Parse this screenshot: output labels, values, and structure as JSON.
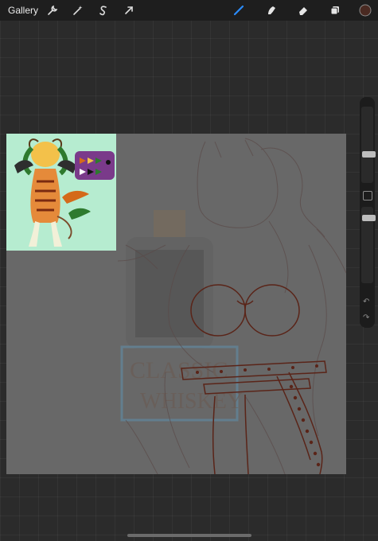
{
  "topbar": {
    "gallery_label": "Gallery",
    "left_tools": [
      "wrench-icon",
      "magic-wand-icon",
      "selection-s-icon",
      "transform-arrow-icon"
    ],
    "right_tools": [
      "brush-icon",
      "smudge-icon",
      "eraser-icon",
      "layers-icon",
      "color-swatch"
    ],
    "active_tool": "brush",
    "active_color": "#4a2a22"
  },
  "canvas": {
    "watermark_line1": "CLASSIC",
    "watermark_line2": "WHISKEY",
    "line_color": "#5a2418",
    "background_color": "#686868"
  },
  "reference": {
    "background_color": "#b6ecd0",
    "palette_colors": [
      "#2e7a2e",
      "#d46a1a",
      "#f3c14a",
      "#7a3a8a",
      "#ffffff",
      "#111111"
    ]
  },
  "sidebar": {
    "undo_icon": "undo-icon",
    "redo_icon": "redo-icon",
    "modify_button": "modify-square-icon"
  }
}
